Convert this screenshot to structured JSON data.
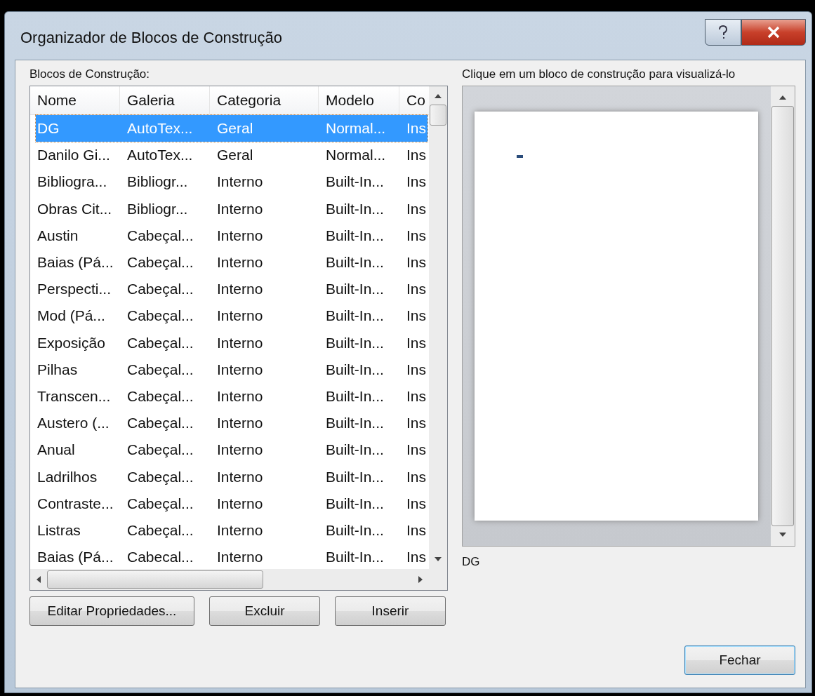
{
  "window": {
    "title": "Organizador de Blocos de Construção"
  },
  "list_label": "Blocos de Construção:",
  "table": {
    "columns": [
      "Nome",
      "Galeria",
      "Categoria",
      "Modelo",
      "Co"
    ],
    "rows": [
      {
        "cells": [
          "DG",
          "AutoTex...",
          "Geral",
          "Normal...",
          "Ins"
        ],
        "selected": true
      },
      {
        "cells": [
          "Danilo Gi...",
          "AutoTex...",
          "Geral",
          "Normal...",
          "Ins"
        ],
        "selected": false
      },
      {
        "cells": [
          "Bibliogra...",
          "Bibliogr...",
          "Interno",
          "Built-In...",
          "Ins"
        ],
        "selected": false
      },
      {
        "cells": [
          "Obras Cit...",
          "Bibliogr...",
          "Interno",
          "Built-In...",
          "Ins"
        ],
        "selected": false
      },
      {
        "cells": [
          "Austin",
          "Cabeçal...",
          "Interno",
          "Built-In...",
          "Ins"
        ],
        "selected": false
      },
      {
        "cells": [
          "Baias (Pá...",
          "Cabeçal...",
          "Interno",
          "Built-In...",
          "Ins"
        ],
        "selected": false
      },
      {
        "cells": [
          "Perspecti...",
          "Cabeçal...",
          "Interno",
          "Built-In...",
          "Ins"
        ],
        "selected": false
      },
      {
        "cells": [
          "Mod (Pá...",
          "Cabeçal...",
          "Interno",
          "Built-In...",
          "Ins"
        ],
        "selected": false
      },
      {
        "cells": [
          "Exposição",
          "Cabeçal...",
          "Interno",
          "Built-In...",
          "Ins"
        ],
        "selected": false
      },
      {
        "cells": [
          "Pilhas",
          "Cabeçal...",
          "Interno",
          "Built-In...",
          "Ins"
        ],
        "selected": false
      },
      {
        "cells": [
          "Transcen...",
          "Cabeçal...",
          "Interno",
          "Built-In...",
          "Ins"
        ],
        "selected": false
      },
      {
        "cells": [
          "Austero (...",
          "Cabeçal...",
          "Interno",
          "Built-In...",
          "Ins"
        ],
        "selected": false
      },
      {
        "cells": [
          "Anual",
          "Cabeçal...",
          "Interno",
          "Built-In...",
          "Ins"
        ],
        "selected": false
      },
      {
        "cells": [
          "Ladrilhos",
          "Cabeçal...",
          "Interno",
          "Built-In...",
          "Ins"
        ],
        "selected": false
      },
      {
        "cells": [
          "Contraste...",
          "Cabeçal...",
          "Interno",
          "Built-In...",
          "Ins"
        ],
        "selected": false
      },
      {
        "cells": [
          "Listras",
          "Cabeçal...",
          "Interno",
          "Built-In...",
          "Ins"
        ],
        "selected": false
      },
      {
        "cells": [
          "Baias (Pá...",
          "Cabecal...",
          "Interno",
          "Built-In...",
          "Ins"
        ],
        "selected": false
      }
    ]
  },
  "preview": {
    "label": "Clique em um bloco de construção para visualizá-lo",
    "caption": "DG"
  },
  "buttons": [
    "Editar Propriedades...",
    "Excluir",
    "Inserir"
  ],
  "close_button": "Fechar"
}
